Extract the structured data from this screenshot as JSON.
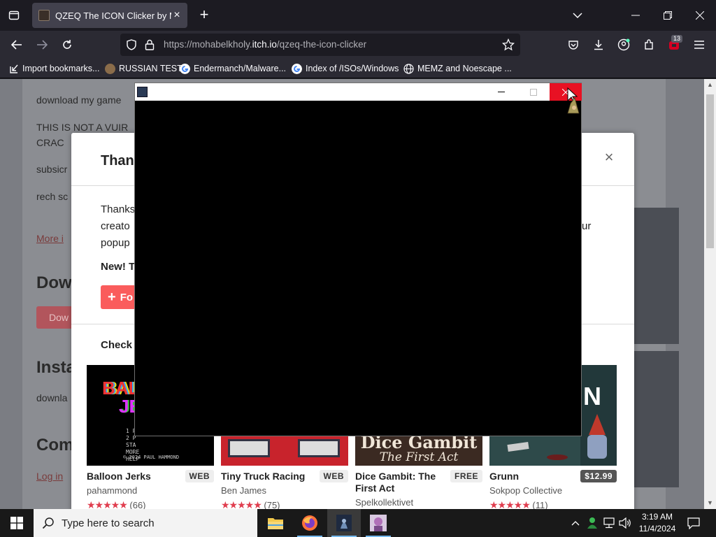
{
  "browser": {
    "tab_title": "QZEQ The ICON Clicker by Moh",
    "url_prefix": "https://mohabelkholy.",
    "url_domain": "itch.io",
    "url_path": "/qzeq-the-icon-clicker",
    "extensions_badge": "13"
  },
  "bookmarks": [
    {
      "label": "Import bookmarks..."
    },
    {
      "label": "RUSSIAN TEST"
    },
    {
      "label": "Endermanch/Malware..."
    },
    {
      "label": "Index of /ISOs/Windows"
    },
    {
      "label": "MEMZ and Noescape ..."
    }
  ],
  "page": {
    "line1": "download my game",
    "line2a": "THIS IS NOT A VUIR",
    "line2b": "CRAC",
    "line3": "subsicr",
    "line4": "rech sc",
    "more_link": "More i",
    "heading_download": "Dow",
    "download_btn": "Dow",
    "heading_install": "Insta",
    "install_text": "downla",
    "heading_comments": "Com",
    "login_link": "Log in"
  },
  "modal": {
    "title": "Thank",
    "text_line1": "Thanks",
    "text_line2": "creato",
    "text_line2_tail": "ur",
    "text_line3": "popup",
    "new_label": "New! T",
    "follow_btn": "Fo",
    "check_heading": "Check o",
    "cards": [
      {
        "title": "Balloon Jerks",
        "price": "WEB",
        "author": "pahammond",
        "rating_count": "(66)",
        "art_text": "© 2024 PAUL HAMMOND"
      },
      {
        "title": "Tiny Truck Racing",
        "price": "WEB",
        "author": "Ben James",
        "rating_count": "(75)"
      },
      {
        "title": "Dice Gambit: The First Act",
        "price": "FREE",
        "author": "Spelkollektivet",
        "art_line1": "Dice Gambit",
        "art_line2": "The First Act"
      },
      {
        "title": "Grunn",
        "price": "$12.99",
        "author": "Sokpop Collective",
        "rating_count": "(11)"
      }
    ]
  },
  "taskbar": {
    "search_placeholder": "Type here to search",
    "time": "3:19 AM",
    "date": "11/4/2024"
  }
}
